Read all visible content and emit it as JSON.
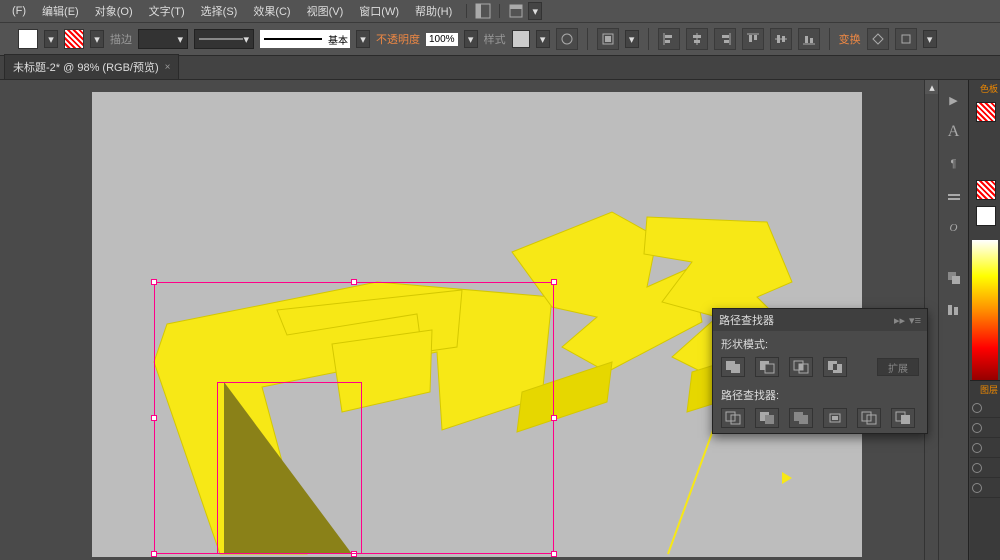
{
  "menu": {
    "file": "(F)",
    "edit": "编辑(E)",
    "object": "对象(O)",
    "text": "文字(T)",
    "select": "选择(S)",
    "effect": "效果(C)",
    "view": "视图(V)",
    "window": "窗口(W)",
    "help": "帮助(H)"
  },
  "options": {
    "stroke_label": "描边",
    "stroke_style": "基本",
    "opacity_label": "不透明度",
    "opacity_value": "100%",
    "style_label": "样式",
    "transform_label": "变换"
  },
  "tab": {
    "title": "未标题-2* @ 98% (RGB/预览)",
    "close": "×"
  },
  "panels": {
    "color": "色板",
    "layers": "图层"
  },
  "pathfinder": {
    "title": "路径查找器",
    "collapse": "▸▸",
    "menu": "▾≡",
    "shape_modes_label": "形状模式:",
    "expand": "扩展",
    "pathfinders_label": "路径查找器:"
  }
}
